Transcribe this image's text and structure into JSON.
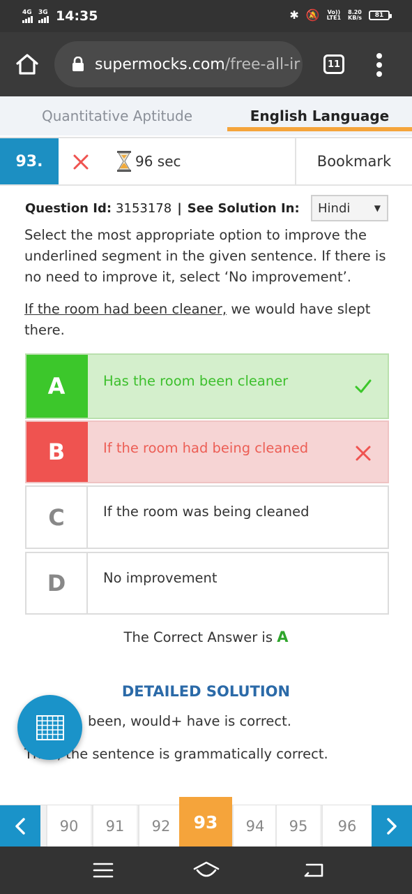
{
  "status_bar": {
    "network1": "4G",
    "network2": "3G",
    "time": "14:35",
    "volte": "Vo))",
    "lte": "LTE1",
    "speed": "8.20",
    "speed_unit": "KB/s",
    "battery": "81"
  },
  "browser": {
    "url_host": "supermocks.com",
    "url_path": "/free-all-ir",
    "tab_count": "11"
  },
  "subject_tabs": [
    {
      "label": "Quantitative Aptitude",
      "active": false
    },
    {
      "label": "English Language",
      "active": true
    }
  ],
  "question_header": {
    "number": "93.",
    "time": "96 sec",
    "bookmark_label": "Bookmark"
  },
  "question": {
    "id_label": "Question Id:",
    "id_value": "3153178",
    "separator": "|",
    "solution_label": "See Solution In:",
    "language_selected": "Hindi",
    "instruction": "Select the most appropriate option to improve the underlined segment in the given sentence. If there is no need to improve it, select ‘No improvement’.",
    "sentence_underlined": "If the room had been cleaner,",
    "sentence_rest": " we would have slept there."
  },
  "options": [
    {
      "letter": "A",
      "text": "Has the room been cleaner",
      "state": "correct"
    },
    {
      "letter": "B",
      "text": "If the room had being cleaned",
      "state": "wrong"
    },
    {
      "letter": "C",
      "text": "If the room was being cleaned",
      "state": "none"
    },
    {
      "letter": "D",
      "text": "No improvement",
      "state": "none"
    }
  ],
  "result": {
    "prefix": "The Correct Answer is ",
    "answer": "A"
  },
  "solution": {
    "title": "DETAILED SOLUTION",
    "line1": "been, would+ have is correct.",
    "line2": "Thus, the sentence is grammatically correct."
  },
  "pagination": {
    "pages": [
      "90",
      "91",
      "92",
      "93",
      "94",
      "95",
      "96"
    ],
    "current": "93"
  },
  "colors": {
    "brand_blue": "#1c8fc2",
    "accent_orange": "#f5a43b",
    "correct_green": "#3cc72b",
    "wrong_red": "#ef5350"
  }
}
